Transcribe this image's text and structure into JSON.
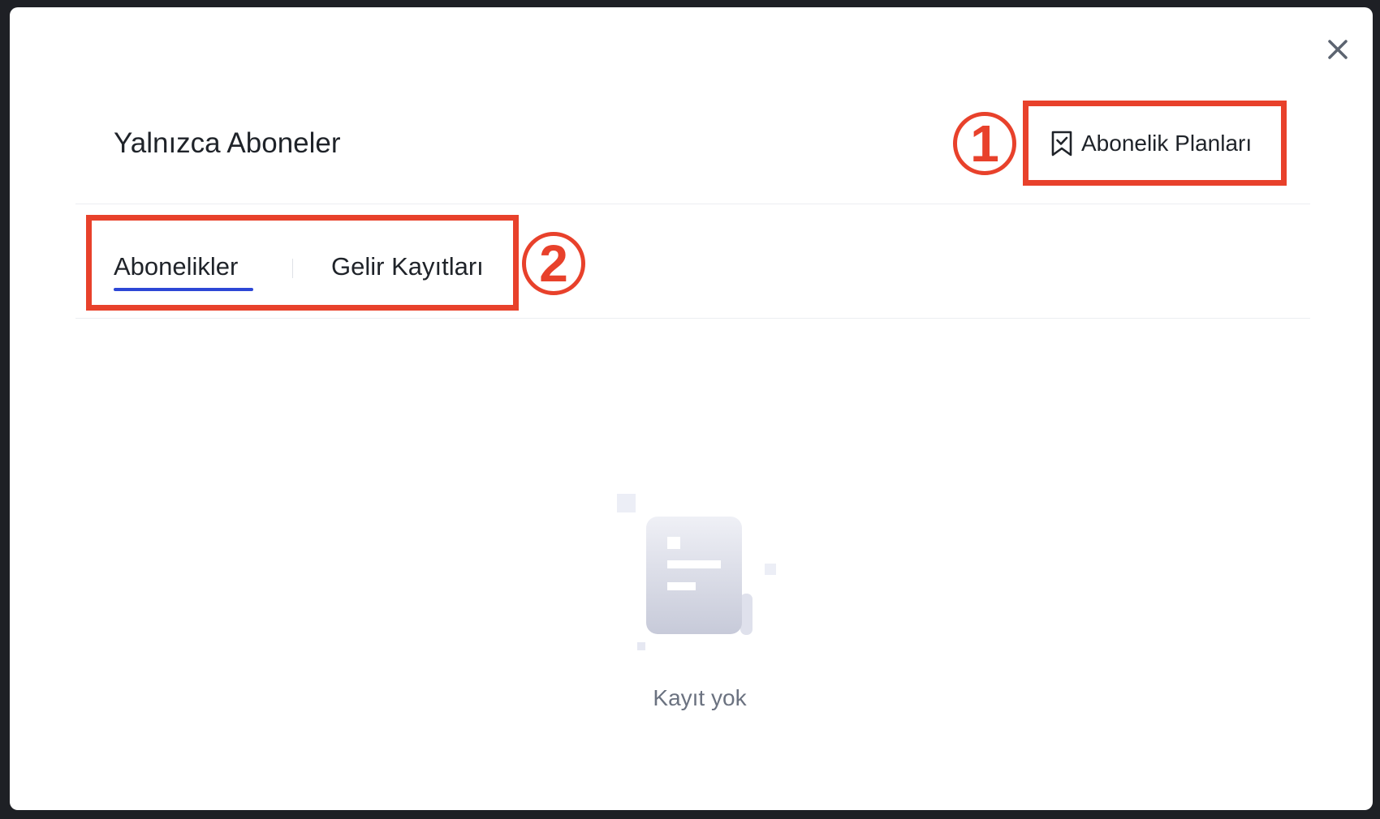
{
  "modal": {
    "title": "Yalnızca Aboneler",
    "plans_button_label": "Abonelik Planları",
    "close_icon": "close-icon"
  },
  "tabs": [
    {
      "label": "Abonelikler",
      "active": true
    },
    {
      "label": "Gelir Kayıtları",
      "active": false
    }
  ],
  "annotations": [
    {
      "number": "1"
    },
    {
      "number": "2"
    }
  ],
  "empty_state": {
    "message": "Kayıt yok",
    "icon": "empty-document-icon"
  },
  "colors": {
    "accent": "#2d47d6",
    "annotation": "#e8412b",
    "text": "#1f2329",
    "muted_text": "#6b7280"
  }
}
